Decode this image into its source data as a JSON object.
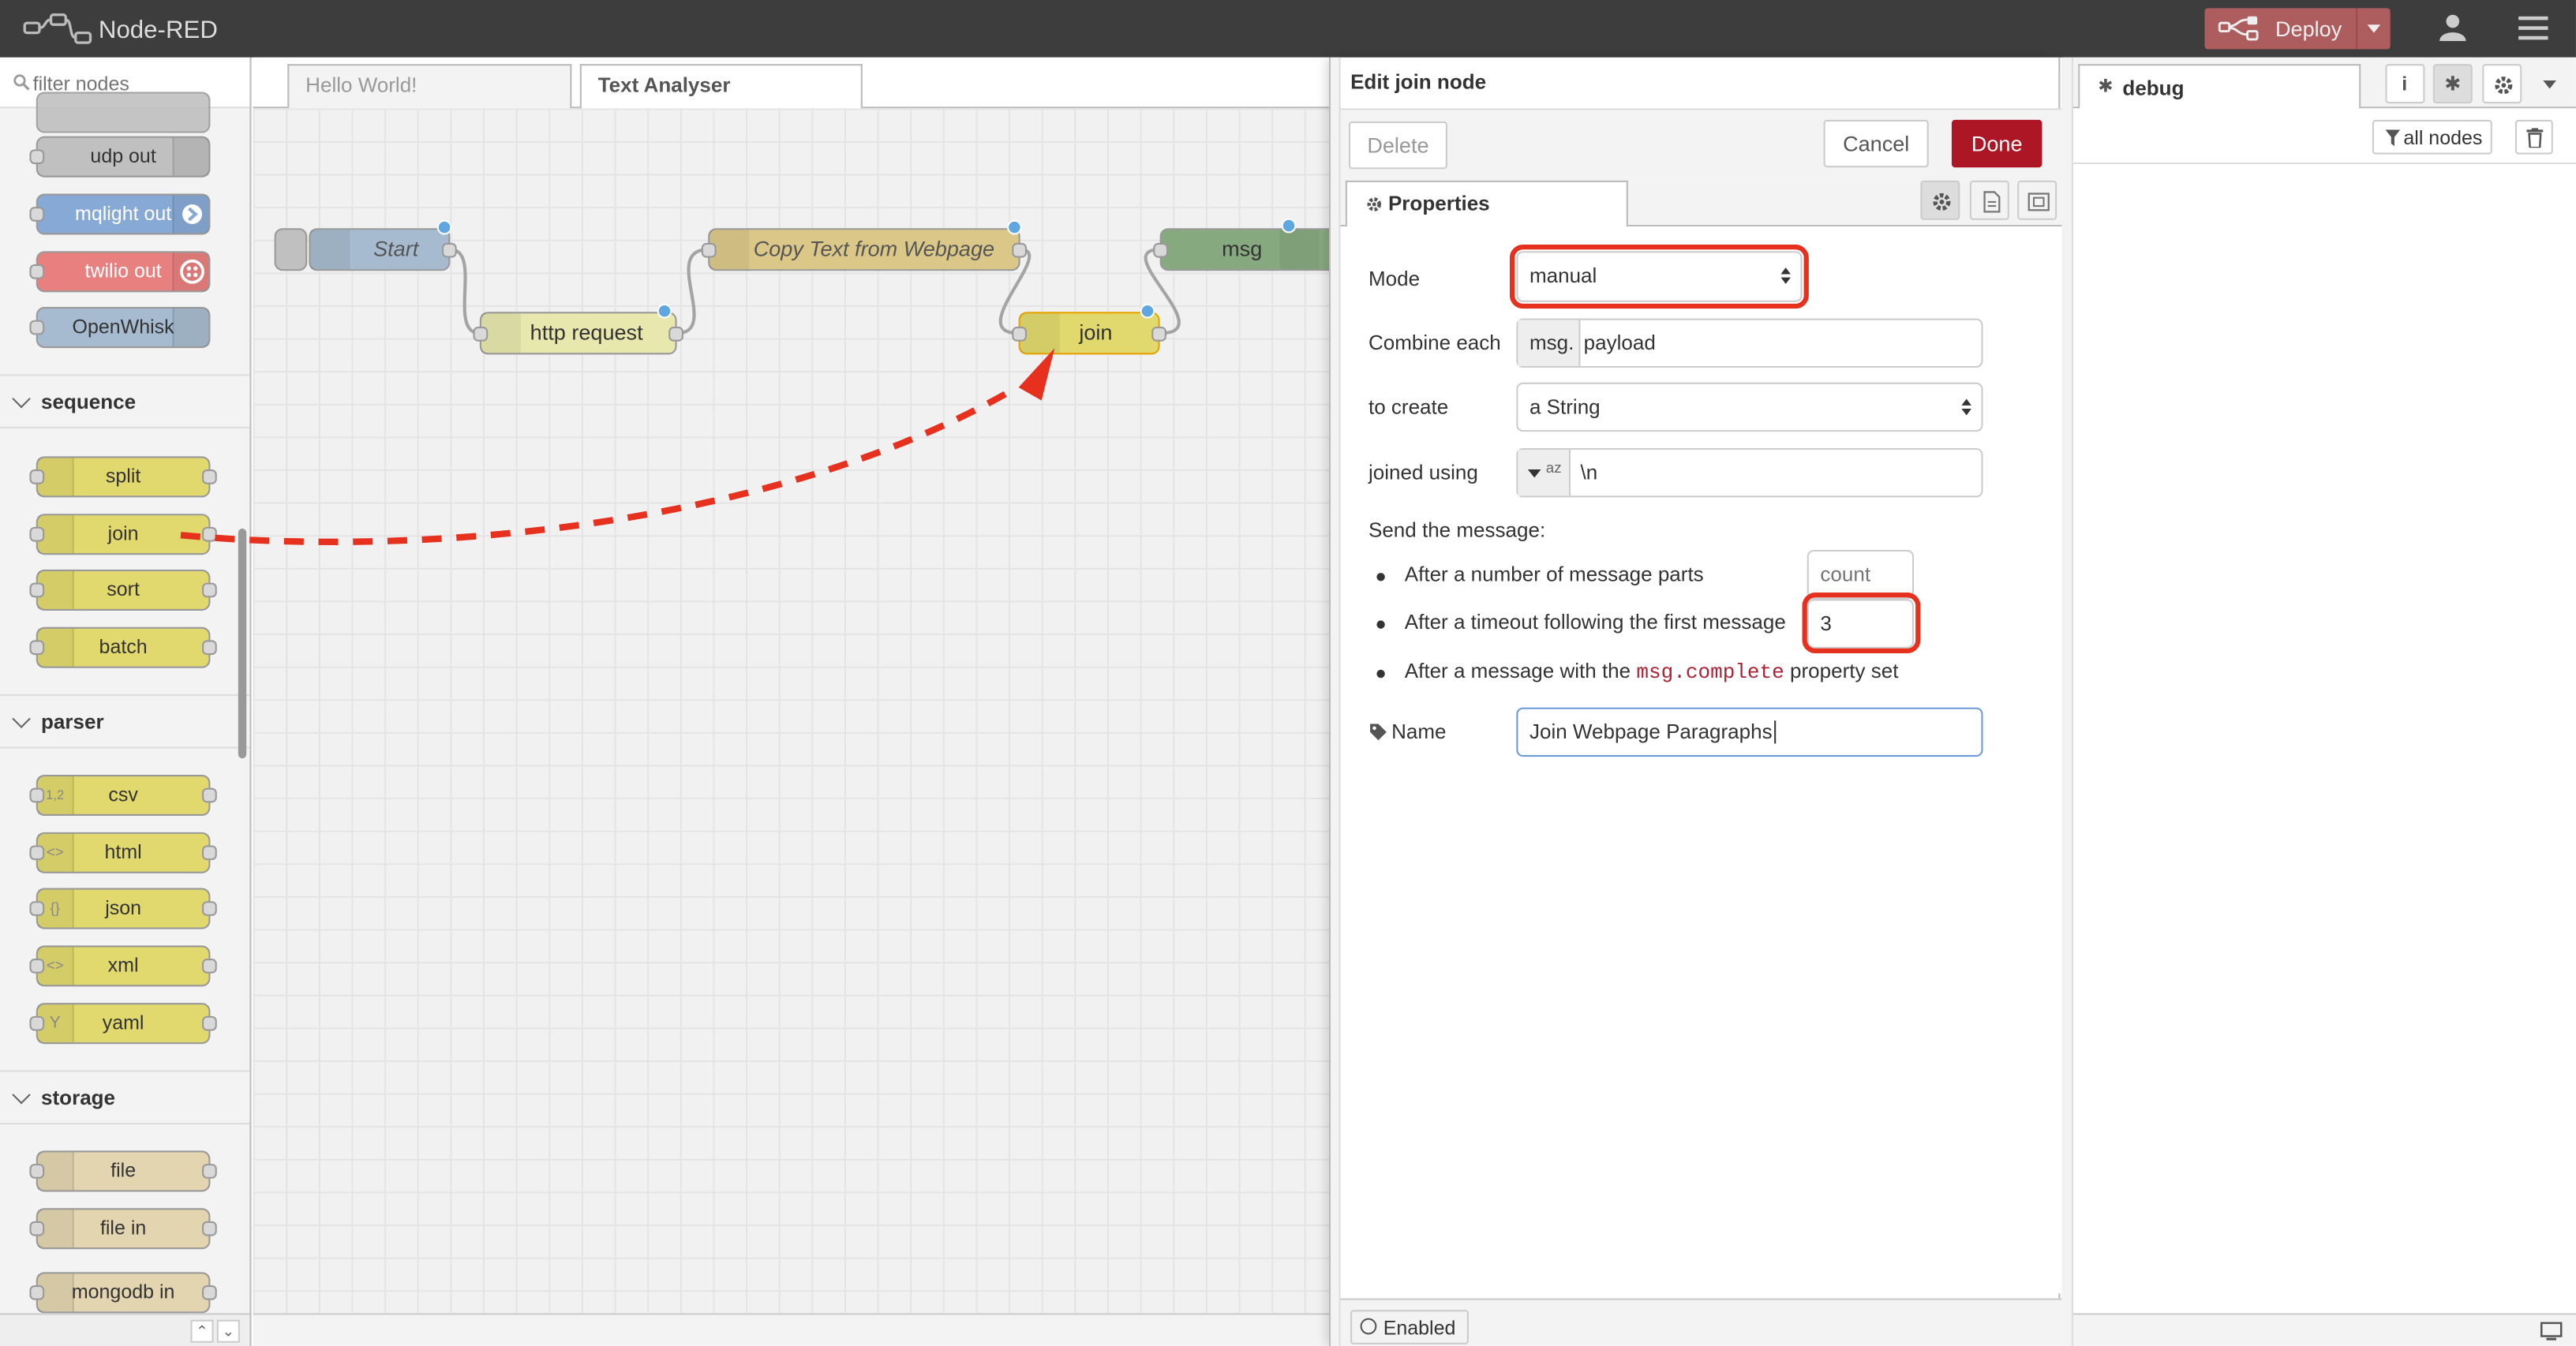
{
  "header": {
    "title": "Node-RED",
    "deploy_label": "Deploy"
  },
  "palette": {
    "filter_placeholder": "filter nodes",
    "top_nodes": [
      {
        "label": "udp out",
        "color": "#c0c0c0"
      },
      {
        "label": "mqlight out",
        "color": "#87a9d6"
      },
      {
        "label": "twilio out",
        "color": "#e88080"
      },
      {
        "label": "OpenWhisk",
        "color": "#a6bbcf"
      }
    ],
    "categories": [
      {
        "name": "sequence",
        "nodes": [
          "split",
          "join",
          "sort",
          "batch"
        ]
      },
      {
        "name": "parser",
        "nodes": [
          "csv",
          "html",
          "json",
          "xml",
          "yaml"
        ]
      },
      {
        "name": "storage",
        "nodes": [
          "file",
          "file in",
          "mongodb in"
        ]
      }
    ],
    "parser_icons": [
      "1,2",
      "<>",
      "{}",
      "<>",
      "Y"
    ]
  },
  "workspace": {
    "tabs": [
      {
        "label": "Hello World!"
      },
      {
        "label": "Text Analyser"
      }
    ],
    "nodes": {
      "start": "Start",
      "http": "http request",
      "copy": "Copy Text from Webpage",
      "join": "join",
      "msg": "msg"
    }
  },
  "tray": {
    "title": "Edit join node",
    "delete_label": "Delete",
    "cancel_label": "Cancel",
    "done_label": "Done",
    "properties_tab": "Properties",
    "mode_label": "Mode",
    "mode_value": "manual",
    "combine_label": "Combine each",
    "combine_prefix": "msg.",
    "combine_value": "payload",
    "create_label": "to create",
    "create_value": "a String",
    "joined_label": "joined using",
    "joined_type": "az",
    "joined_value": "\\n",
    "send_label": "Send the message:",
    "opt_count": "After a number of message parts",
    "count_placeholder": "count",
    "opt_timeout": "After a timeout following the first message",
    "timeout_value": "3",
    "opt_complete_pre": "After a message with the",
    "opt_complete_code": "msg.complete",
    "opt_complete_post": "property set",
    "name_label": "Name",
    "name_value": "Join Webpage Paragraphs",
    "enabled_label": "Enabled"
  },
  "sidebar": {
    "tab_label": "debug",
    "filter_label": "all nodes"
  },
  "colors": {
    "highlight": "#e5311e",
    "deploy": "#ad5d5d",
    "done": "#ad1625",
    "function_node": "#e2d96e",
    "port_dot": "#5ea7e0"
  }
}
